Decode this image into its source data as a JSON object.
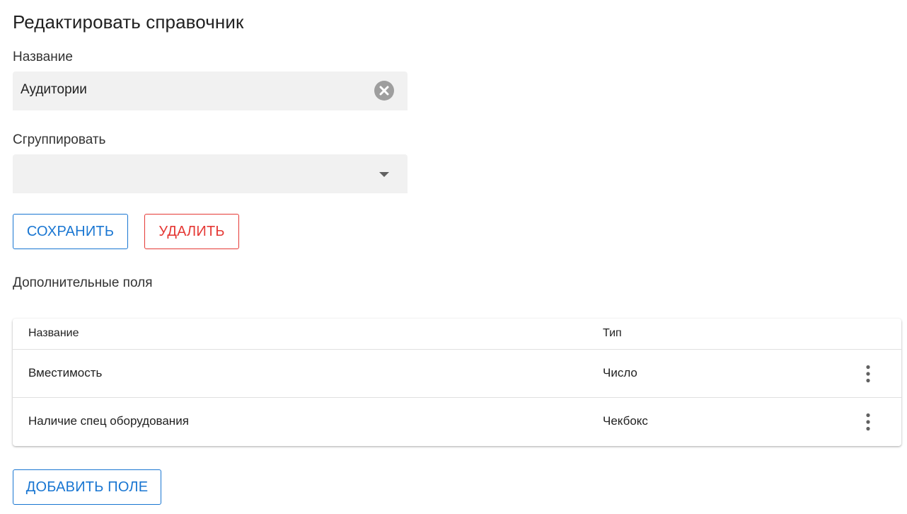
{
  "page_title": "Редактировать справочник",
  "form": {
    "name_label": "Название",
    "name_value": "Аудитории",
    "group_label": "Сгруппировать",
    "group_value": ""
  },
  "actions": {
    "save_label": "СОХРАНИТЬ",
    "delete_label": "УДАЛИТЬ"
  },
  "extra_fields": {
    "section_title": "Дополнительные поля",
    "columns": [
      "Название",
      "Тип"
    ],
    "rows": [
      {
        "name": "Вместимость",
        "type": "Число"
      },
      {
        "name": "Наличие спец оборудования",
        "type": "Чекбокс"
      }
    ],
    "add_label": "ДОБАВИТЬ ПОЛЕ"
  },
  "icons": {
    "clear": "clear-icon",
    "dropdown": "dropdown-arrow-icon",
    "row_menu": "more-vert-icon"
  },
  "colors": {
    "primary": "#1976d2",
    "danger": "#e53935",
    "field_bg": "#f1f1f1",
    "icon_gray": "#9e9e9e"
  }
}
